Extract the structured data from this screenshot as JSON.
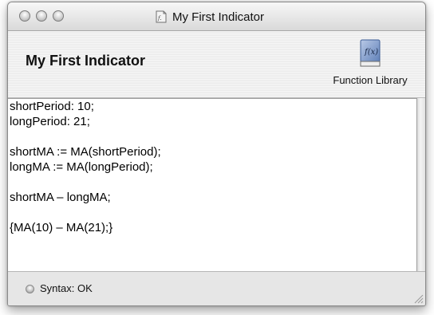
{
  "window": {
    "title": "My First Indicator",
    "title_icon": "function-document-icon"
  },
  "header": {
    "indicator_name": "My First Indicator",
    "function_library": {
      "label": "Function Library",
      "icon": "function-book-icon",
      "icon_glyph": "f(x)"
    }
  },
  "editor": {
    "lines": [
      "shortPeriod: 10;",
      "longPeriod: 21;",
      "",
      "shortMA := MA(shortPeriod);",
      "longMA := MA(longPeriod);",
      "",
      "shortMA – longMA;",
      "",
      "{MA(10) – MA(21);}"
    ]
  },
  "status": {
    "text": "Syntax: OK",
    "indicator_icon": "status-light-icon"
  }
}
